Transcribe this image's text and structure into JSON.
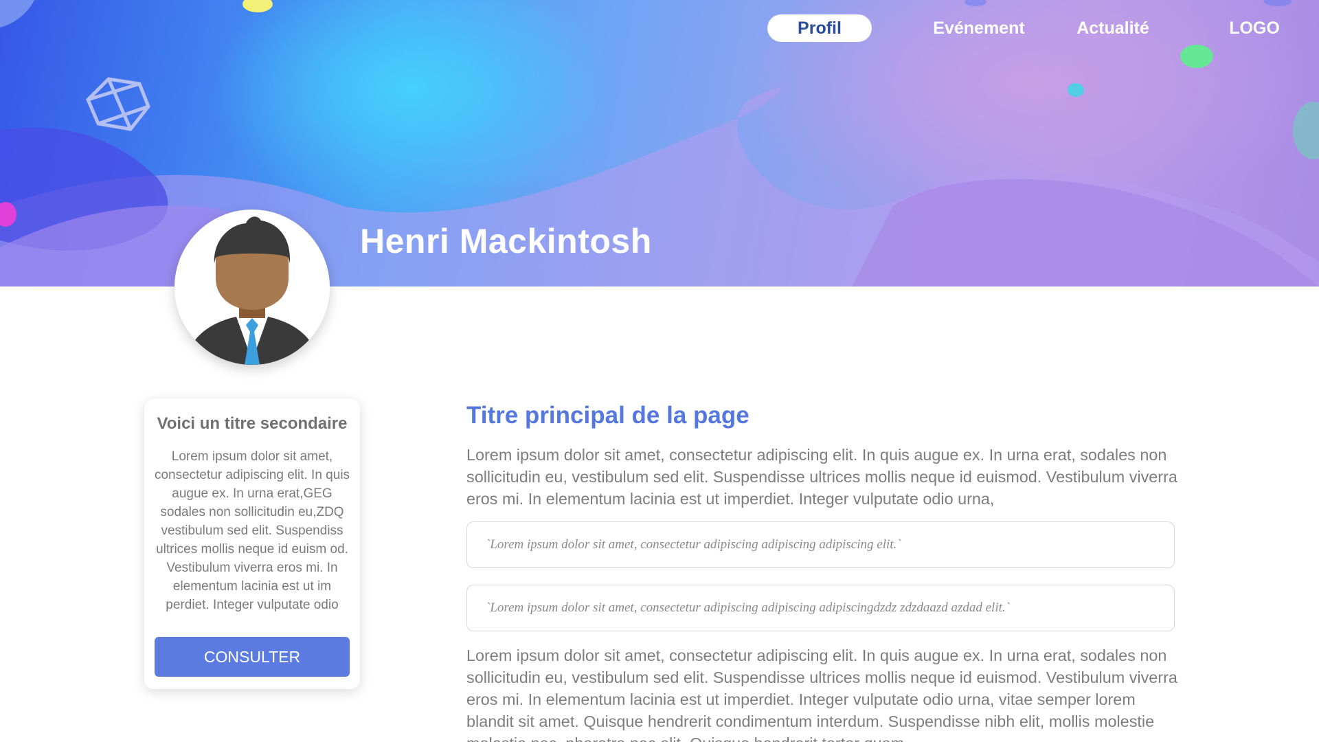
{
  "nav": {
    "items": [
      {
        "label": "Profil",
        "active": true
      },
      {
        "label": "Evénement",
        "active": false
      },
      {
        "label": "Actualité",
        "active": false
      }
    ],
    "logo": "LOGO"
  },
  "profile": {
    "name": "Henri Mackintosh",
    "avatar_icon": "businessman-avatar-icon"
  },
  "sidebar_card": {
    "title": "Voici un titre secondaire",
    "text": "Lorem ipsum dolor sit amet, consectetur adipiscing elit. In quis augue ex. In urna erat,GEG sodales non sollicitudin eu,ZDQ vestibulum sed elit. Suspendiss ultrices mollis neque id euism od. Vestibulum viverra eros mi. In elementum lacinia est ut im perdiet. Integer vulputate odio",
    "button_label": "CONSULTER"
  },
  "main": {
    "title": "Titre principal de la page",
    "paragraph1": "Lorem ipsum dolor sit amet, consectetur adipiscing elit. In quis augue ex. In urna erat, sodales non sollicitudin eu, vestibulum sed elit. Suspendisse ultrices mollis neque id euismod. Vestibulum viverra eros mi. In elementum lacinia est ut imperdiet. Integer vulputate odio urna,",
    "quote1": "`Lorem ipsum dolor sit amet, consectetur adipiscing adipiscing adipiscing elit.`",
    "quote2": "`Lorem ipsum dolor sit amet, consectetur adipiscing adipiscing adipiscingdzdz zdzdaazd azdad elit.`",
    "paragraph2": "Lorem ipsum dolor sit amet, consectetur adipiscing elit. In quis augue ex. In urna erat, sodales non sollicitudin eu, vestibulum sed elit. Suspendisse ultrices mollis neque id euismod. Vestibulum viverra eros mi. In elementum lacinia est ut imperdiet. Integer vulputate odio urna, vitae semper lorem blandit sit amet. Quisque hendrerit condimentum interdum. Suspendisse nibh elit, mollis molestie molestie nec, pharetra nec elit. Quisque hendrerit tortor quam"
  },
  "colors": {
    "accent": "#5478df",
    "button": "#5b7be1",
    "nav_active_text": "#2a4c9c",
    "body_text": "#7d7d7d"
  }
}
